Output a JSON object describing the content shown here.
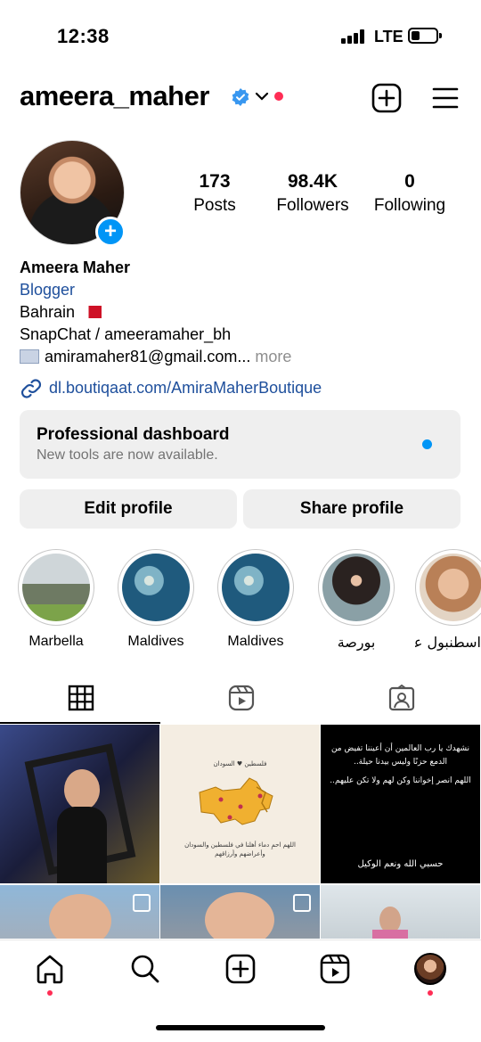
{
  "status_bar": {
    "time": "12:38",
    "network": "LTE",
    "battery_level": 0.3
  },
  "header": {
    "username": "ameera_maher"
  },
  "stats": [
    {
      "num": "173",
      "label": "Posts"
    },
    {
      "num": "98.4K",
      "label": "Followers"
    },
    {
      "num": "0",
      "label": "Following"
    }
  ],
  "bio": {
    "name": "Ameera Maher",
    "category": "Blogger",
    "location": "Bahrain",
    "snapchat": "SnapChat / ameeramaher_bh",
    "email": "amiramaher81@gmail.com...",
    "more": "more",
    "link": "dl.boutiqaat.com/AmiraMaherBoutique"
  },
  "dashboard": {
    "title": "Professional dashboard",
    "subtitle": "New tools are now available."
  },
  "buttons": {
    "edit": "Edit profile",
    "share": "Share profile"
  },
  "highlights": [
    {
      "label": "Marbella"
    },
    {
      "label": "Maldives"
    },
    {
      "label": "Maldives"
    },
    {
      "label": "بورصة"
    },
    {
      "label": "اسطنبول عائلية"
    }
  ],
  "posts": {
    "post3_text": "نشهدك يا رب العالمين أن أعيننا تفيض من الدمع حزنًا وليس بيدنا حيلة..",
    "post3_text2": "اللهم انصر إخواننا وكن لهم ولا تكن عليهم..",
    "post3_footer": "حسبي الله ونعم الوكيل",
    "post2_top": "فلسطين ♥ السودان",
    "post2_bottom": "اللهم احمِ دماء أهلنا في فلسطين والسودان وأعراضهم وأرزاقهم"
  },
  "colors": {
    "accent": "#0095f6",
    "link": "#1e4f9c",
    "notification": "#ff2d55"
  }
}
